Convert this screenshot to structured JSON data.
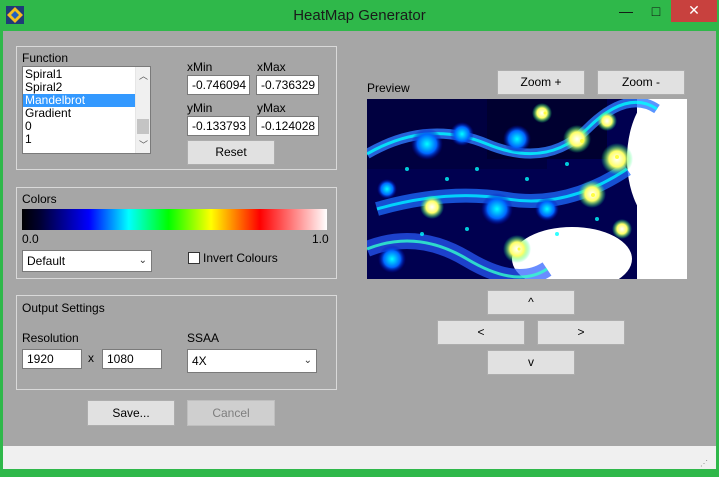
{
  "window": {
    "title": "HeatMap Generator",
    "minimize": "—",
    "maximize": "□",
    "close": "✕"
  },
  "function_group": {
    "label": "Function",
    "items": [
      "Spiral1",
      "Spiral2",
      "Mandelbrot",
      "Gradient",
      "0",
      "1"
    ],
    "selected_index": 2
  },
  "bounds": {
    "xmin_label": "xMin",
    "xmin_value": "-0.746094",
    "xmax_label": "xMax",
    "xmax_value": "-0.736329",
    "ymin_label": "yMin",
    "ymin_value": "-0.133793",
    "ymax_label": "yMax",
    "ymax_value": "-0.124028",
    "reset_label": "Reset"
  },
  "colors_group": {
    "label": "Colors",
    "scale_min": "0.0",
    "scale_max": "1.0",
    "palette": "Default",
    "invert_label": "Invert Colours",
    "invert_checked": false,
    "gradient_stops": [
      "#000000",
      "#000033",
      "#0000ff",
      "#00ffff",
      "#00ff00",
      "#ffff00",
      "#ff0000",
      "#ffffff"
    ]
  },
  "output_group": {
    "label": "Output Settings",
    "resolution_label": "Resolution",
    "width": "1920",
    "times": "x",
    "height": "1080",
    "ssaa_label": "SSAA",
    "ssaa_value": "4X"
  },
  "actions": {
    "save_label": "Save...",
    "cancel_label": "Cancel"
  },
  "preview": {
    "label": "Preview",
    "zoom_in_label": "Zoom +",
    "zoom_out_label": "Zoom -",
    "up_label": "^",
    "left_label": "<",
    "right_label": ">",
    "down_label": "v"
  }
}
